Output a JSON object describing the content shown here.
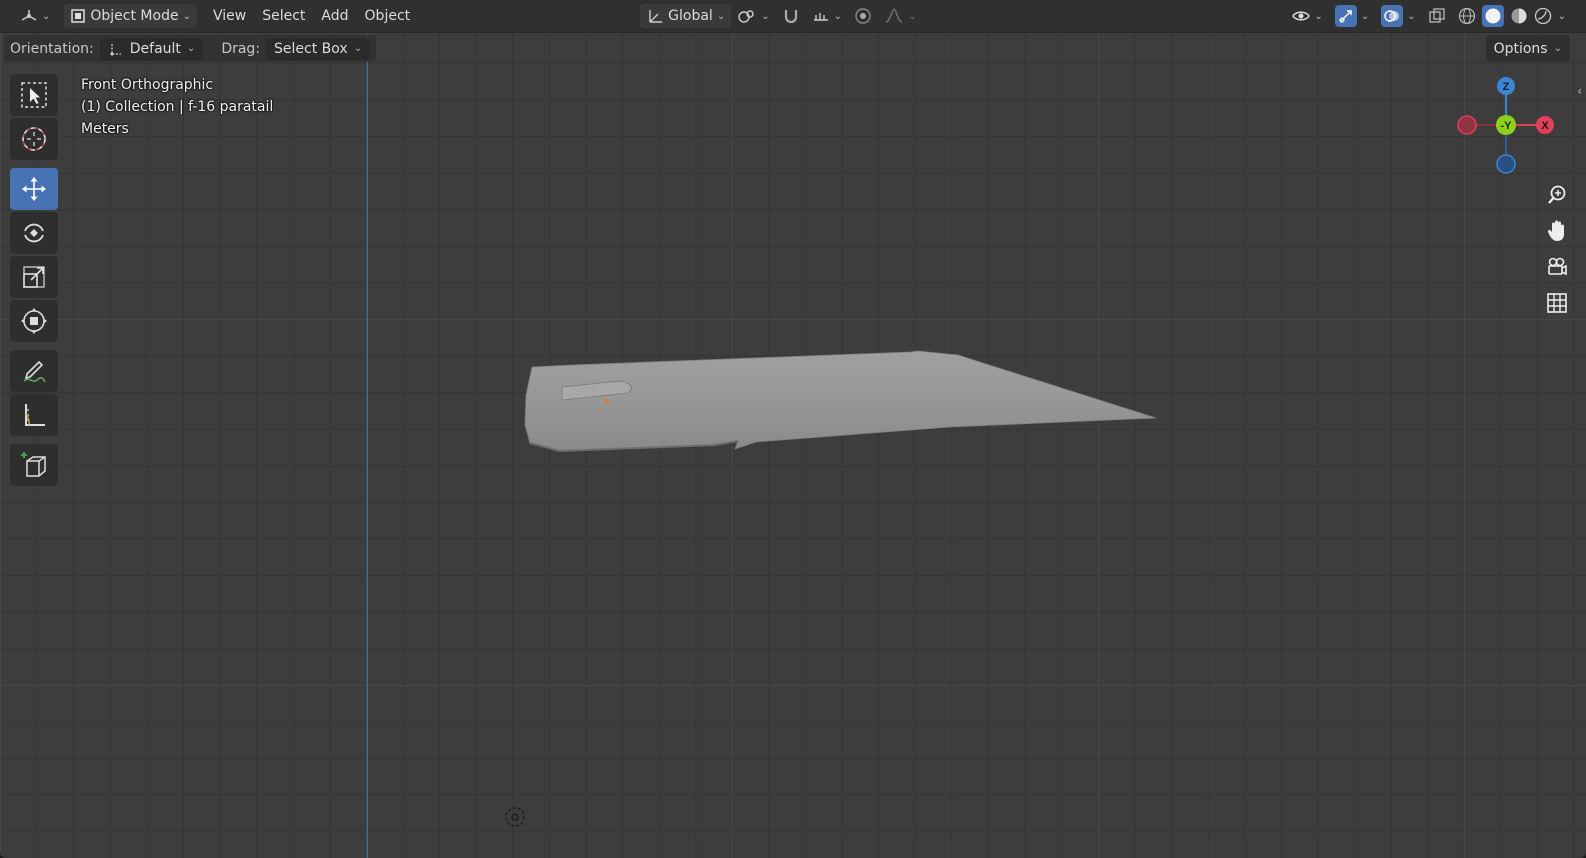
{
  "header": {
    "editor_type_icon": "viewport-editor-icon",
    "mode": "Object Mode",
    "menus": [
      "View",
      "Select",
      "Add",
      "Object"
    ],
    "transform_orientation": "Global"
  },
  "toolbar": {
    "orientation_label": "Orientation:",
    "orientation_value": "Default",
    "drag_label": "Drag:",
    "drag_value": "Select Box",
    "options_label": "Options"
  },
  "tools": [
    {
      "name": "select-box-tool",
      "icon": "select-box-icon",
      "active": false
    },
    {
      "name": "cursor-tool",
      "icon": "cursor-icon",
      "active": false
    },
    {
      "name": "move-tool",
      "icon": "move-icon",
      "active": true
    },
    {
      "name": "rotate-tool",
      "icon": "rotate-icon",
      "active": false
    },
    {
      "name": "scale-tool",
      "icon": "scale-icon",
      "active": false
    },
    {
      "name": "transform-tool",
      "icon": "transform-icon",
      "active": false
    },
    {
      "name": "annotate-tool",
      "icon": "annotate-icon",
      "active": false
    },
    {
      "name": "measure-tool",
      "icon": "measure-icon",
      "active": false
    },
    {
      "name": "add-cube-tool",
      "icon": "add-cube-icon",
      "active": false
    }
  ],
  "viewport_info": {
    "view_name": "Front Orthographic",
    "collection": "(1) Collection | f-16 paratail",
    "units": "Meters"
  },
  "gizmo": {
    "z_label": "Z",
    "y_label": "-Y",
    "x_label": "X",
    "x_color": "#e0405a",
    "y_color": "#8ccf1c",
    "z_color": "#3a86d4"
  },
  "colors": {
    "accent": "#4772b3",
    "z_axis_line": "#3d6bb8"
  }
}
